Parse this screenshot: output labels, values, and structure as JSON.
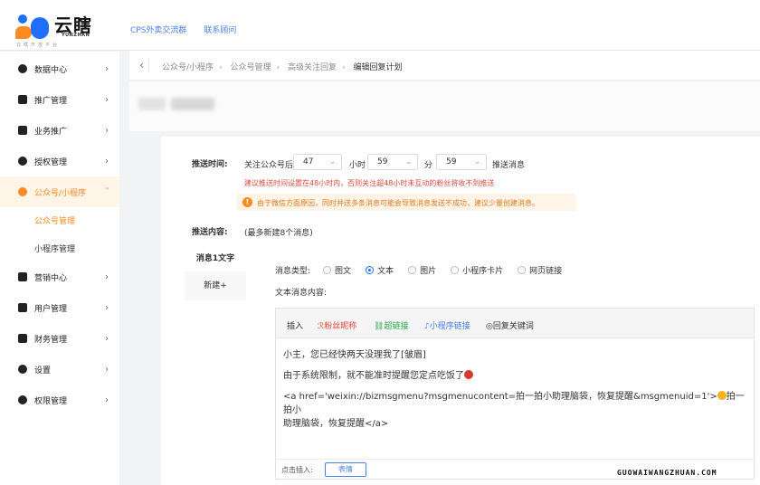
{
  "app": {
    "logo_text": "云瞎",
    "logo_en": "YUNZHAN",
    "logo_sub": "云瞎开放平台"
  },
  "top_links": [
    "CPS外卖交流群",
    "联系顾问"
  ],
  "sidebar": {
    "items": [
      {
        "label": "数据中心",
        "icon": "chart-icon"
      },
      {
        "label": "推广管理",
        "icon": "grid-icon"
      },
      {
        "label": "业务推广",
        "icon": "card-icon"
      },
      {
        "label": "授权管理",
        "icon": "user-lock-icon"
      },
      {
        "label": "公众号/小程序",
        "icon": "miniprogram-icon",
        "active": true
      },
      {
        "label": "营销中心",
        "icon": "shop-icon"
      },
      {
        "label": "用户管理",
        "icon": "users-icon"
      },
      {
        "label": "财务管理",
        "icon": "wallet-icon"
      },
      {
        "label": "设置",
        "icon": "gear-icon"
      },
      {
        "label": "权限管理",
        "icon": "shield-icon"
      }
    ],
    "subitems": [
      {
        "label": "公众号管理",
        "current": true
      },
      {
        "label": "小程序管理"
      }
    ]
  },
  "breadcrumb": [
    "公众号/小程序",
    "公众号管理",
    "高级关注回复",
    "编辑回复计划"
  ],
  "schedule": {
    "label": "推送时间:",
    "prefix": "关注公众号后",
    "hours": "47",
    "hours_unit": "小时",
    "minutes": "59",
    "minutes_unit": "分",
    "seconds": "59",
    "suffix": "推送消息",
    "red_tip": "建议推送时间设置在48小时内，否则关注超48小时未互动的粉丝将收不到推送",
    "warn_tip": "由于微信方面原因，同时并送多条消息可能会导致消息发送不成功，建议少量创建消息。"
  },
  "content": {
    "label": "推送内容:",
    "hint": "(最多新建8个消息)"
  },
  "tabs": [
    "消息1文字",
    "新建+"
  ],
  "msg_type": {
    "label": "消息类型:",
    "options": [
      {
        "label": "图文",
        "selected": false
      },
      {
        "label": "文本",
        "selected": true
      },
      {
        "label": "图片",
        "selected": false
      },
      {
        "label": "小程序卡片",
        "selected": false
      },
      {
        "label": "网页链接",
        "selected": false
      }
    ]
  },
  "text_content_label": "文本消息内容:",
  "toolbar": {
    "insert": "插入",
    "nickname": "粉丝昵称",
    "link": "超链接",
    "mini_link": "小程序链接",
    "reply_keyword": "回复关键词"
  },
  "editor": {
    "line1": "小主，您已经快两天没理我了[皱眉]",
    "line2": "由于系统限制，就不能准时提醒您定点吃饭了",
    "line3a": "<a href='weixin://bizmsgmenu?msgmenucontent=拍一拍小助理脑袋，恢复提醒&msgmenuid=1'>",
    "line3b": "拍一拍小",
    "line3c": "助理脑袋，恢复提醒</a>"
  },
  "insert_row": {
    "label": "点击插入:",
    "button": "表情"
  },
  "watermark": "GUOWAIWANGZHUAN.COM",
  "colors": {
    "accent": "#ff8a1f",
    "link": "#4a7ee8",
    "danger": "#e04a3a",
    "nickname": "#e04a3a",
    "hyperlink": "#2aa84a",
    "mini": "#4a7ee8"
  }
}
